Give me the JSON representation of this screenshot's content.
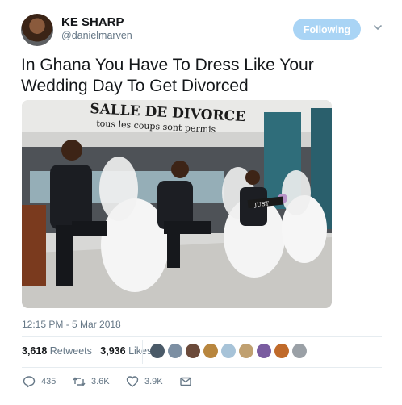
{
  "user": {
    "name": "KE SHARP",
    "handle": "@danielmarven"
  },
  "follow_button": "Following",
  "tweet": {
    "text": "In Ghana You Have To Dress Like Your Wedding Day To Get Divorced",
    "image_sign_line1": "SALLE DE DIVORCE",
    "image_sign_line2": "tous les coups sont permis",
    "image_banner": "JUST"
  },
  "timestamp": "12:15 PM - 5 Mar 2018",
  "stats": {
    "retweets_count": "3,618",
    "retweets_label": "Retweets",
    "likes_count": "3,936",
    "likes_label": "Likes"
  },
  "liker_avatar_colors": [
    "#4a5a68",
    "#7c8fa3",
    "#6b4a3a",
    "#b8863e",
    "#a7c3d8",
    "#c0a070",
    "#7a5ca0",
    "#c06a2a",
    "#9aa0a6"
  ],
  "actions": {
    "replies": "435",
    "retweets": "3.6K",
    "likes": "3.9K"
  },
  "icons": [
    "chevron-down-icon",
    "reply-icon",
    "retweet-icon",
    "like-icon",
    "message-icon"
  ]
}
